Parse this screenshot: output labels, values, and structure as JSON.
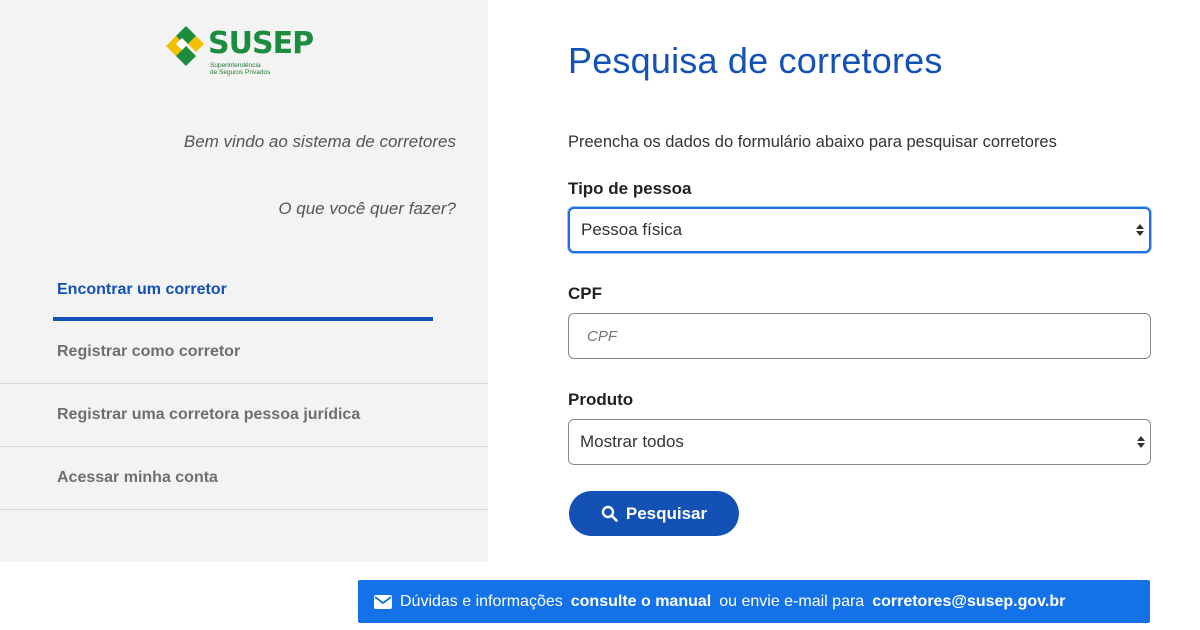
{
  "sidebar": {
    "logo": {
      "name": "SUSEP",
      "subtitle_line1": "Superintendência",
      "subtitle_line2": "de Seguros Privados"
    },
    "welcome": "Bem vindo ao sistema de corretores",
    "question": "O que você quer fazer?",
    "nav": [
      {
        "label": "Encontrar um corretor",
        "active": true
      },
      {
        "label": "Registrar como corretor",
        "active": false
      },
      {
        "label": "Registrar uma corretora pessoa jurídica",
        "active": false
      },
      {
        "label": "Acessar minha conta",
        "active": false
      }
    ]
  },
  "main": {
    "title": "Pesquisa de corretores",
    "intro": "Preencha os dados do formulário abaixo para pesquisar corretores",
    "fields": {
      "tipo_pessoa": {
        "label": "Tipo de pessoa",
        "value": "Pessoa física"
      },
      "cpf": {
        "label": "CPF",
        "value": "",
        "placeholder": "CPF"
      },
      "produto": {
        "label": "Produto",
        "value": "Mostrar todos"
      }
    },
    "search_button": {
      "label": "Pesquisar",
      "icon": "search-icon"
    }
  },
  "footer": {
    "icon": "envelope-icon",
    "text_1": "Dúvidas e informações",
    "link_manual": "consulte o manual",
    "text_2": "ou envie e-mail para",
    "email": "corretores@susep.gov.br"
  },
  "colors": {
    "primary": "#1351b4",
    "footer_bg": "#1472e8",
    "sidebar_bg": "#f3f3f3",
    "logo_green": "#1c8c3e",
    "logo_yellow": "#f2c200"
  }
}
